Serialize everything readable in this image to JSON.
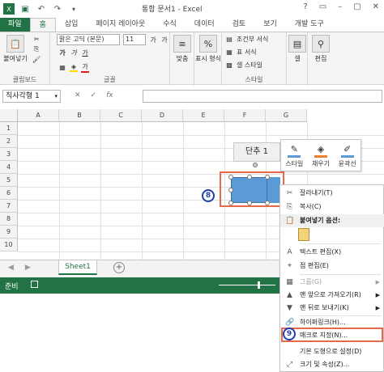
{
  "window": {
    "title": "통합 문서1 - Excel",
    "controls": [
      "?",
      "▭",
      "–",
      "▢",
      "✕"
    ]
  },
  "tabs": [
    "파일",
    "홈",
    "삽입",
    "페이지 레이아웃",
    "수식",
    "데이터",
    "검토",
    "보기",
    "개발 도구"
  ],
  "ribbon": {
    "clipboard": {
      "label": "클립보드",
      "paste": "붙여넣기"
    },
    "font": {
      "label": "글꼴",
      "font_name": "맑은 고딕 (본문)",
      "font_size": "11",
      "bold": "가",
      "italic": "가",
      "underline": "가",
      "grow": "가",
      "shrink": "가",
      "color": "가"
    },
    "align": {
      "label": "맞춤"
    },
    "number": {
      "label": "표시 형식",
      "percent": "%"
    },
    "styles": {
      "label": "스타일",
      "conditional": "조건부 서식",
      "table": "표 서식",
      "cell_style": "셀 스타일"
    },
    "cells": {
      "label": "셀"
    },
    "editing": {
      "label": "편집"
    }
  },
  "formula_bar": {
    "name_box": "직사각형 1",
    "cancel": "✕",
    "enter": "✓",
    "fx": "fx",
    "value": ""
  },
  "grid": {
    "columns": [
      "A",
      "B",
      "C",
      "D",
      "E",
      "F",
      "G"
    ],
    "rows": [
      "1",
      "2",
      "3",
      "4",
      "5",
      "6",
      "7",
      "8",
      "9",
      "10"
    ]
  },
  "floating_button": {
    "label": "단추 1"
  },
  "annotations": {
    "step8": "8",
    "step9": "9"
  },
  "mini_toolbar": [
    {
      "label": "스타일",
      "icon": "style-pen-icon",
      "color": "#5b9bd5"
    },
    {
      "label": "채우기",
      "icon": "fill-bucket-icon",
      "color": "#ed7d31"
    },
    {
      "label": "윤곽선",
      "icon": "outline-pen-icon",
      "color": "#5b9bd5"
    }
  ],
  "sheet_bar": {
    "sheet_name": "Sheet1",
    "add": "+"
  },
  "status": {
    "ready": "준비"
  },
  "context_menu": [
    {
      "label": "잘라내기(T)",
      "icon": "✂",
      "state": "normal"
    },
    {
      "label": "복사(C)",
      "icon": "⎘",
      "state": "normal"
    },
    {
      "label": "붙여넣기 옵션:",
      "icon": "📋",
      "state": "header"
    },
    {
      "label": "텍스트 편집(X)",
      "icon": "A",
      "state": "normal"
    },
    {
      "label": "점 편집(E)",
      "icon": "⌖",
      "state": "normal"
    },
    {
      "label": "그룹(G)",
      "icon": "▦",
      "state": "disabled",
      "submenu": true
    },
    {
      "label": "맨 앞으로 가져오기(R)",
      "icon": "▲",
      "state": "normal",
      "submenu": true
    },
    {
      "label": "맨 뒤로 보내기(K)",
      "icon": "▼",
      "state": "normal",
      "submenu": true
    },
    {
      "label": "하이퍼링크(H)...",
      "icon": "🔗",
      "state": "normal"
    },
    {
      "label": "매크로 지정(N)...",
      "icon": "",
      "state": "highlight"
    },
    {
      "label": "기본 도형으로 설정(D)",
      "icon": "",
      "state": "normal"
    },
    {
      "label": "크기 및 속성(Z)...",
      "icon": "⤢",
      "state": "normal"
    }
  ],
  "colors": {
    "excel_green": "#217346",
    "shape_fill": "#5b9bd5",
    "callout_orange": "#e8694a",
    "step_blue": "#1f3fae"
  }
}
